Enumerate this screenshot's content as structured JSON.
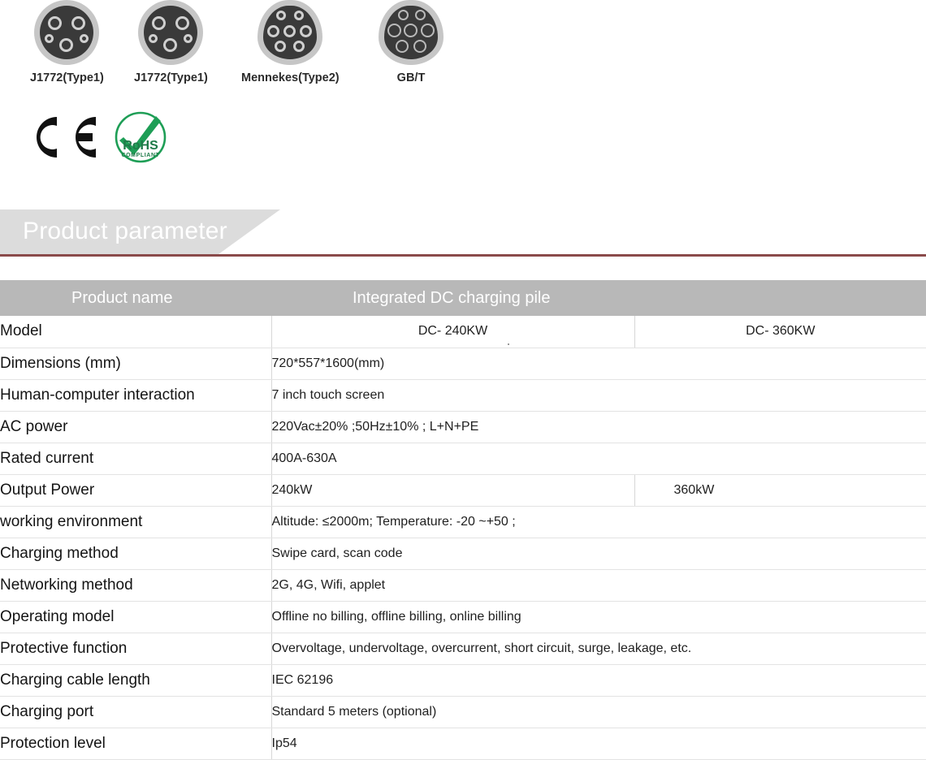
{
  "connectors": [
    {
      "label": "J1772(Type1)",
      "icon": "j1772-type1-connector-icon",
      "shape": "round"
    },
    {
      "label": "J1772(Type1)",
      "icon": "j1772-type1-connector-icon",
      "shape": "round"
    },
    {
      "label": "Mennekes(Type2)",
      "icon": "mennekes-type2-connector-icon",
      "shape": "dshape"
    },
    {
      "label": "GB/T",
      "icon": "gbt-connector-icon",
      "shape": "dshape"
    }
  ],
  "certifications": [
    {
      "name": "ce-mark-icon",
      "label": "CE"
    },
    {
      "name": "rohs-compliant-icon",
      "label": "RoHS",
      "sublabel": "COMPLIANT"
    }
  ],
  "section": {
    "title": "Product parameter",
    "rule_color": "#8a4a4a",
    "banner_color": "#dcdcdc"
  },
  "table": {
    "header": {
      "name_label": "Product name",
      "value_label": "Integrated DC charging pile",
      "background": "#b8b8b8"
    },
    "rows": [
      {
        "label": "Model",
        "value_a": "DC-  240KW",
        "value_b": "DC-  360KW",
        "split": true,
        "centered": true
      },
      {
        "label": "Dimensions (mm)",
        "value_a": "720*557*1600(mm)",
        "split": false,
        "centered": false
      },
      {
        "label": "Human-computer interaction",
        "value_a": "7 inch touch screen",
        "split": false,
        "centered": false
      },
      {
        "label": "AC power",
        "value_a": "220Vac±20% ;50Hz±10% ; L+N+PE",
        "split": false,
        "centered": false
      },
      {
        "label": "Rated current",
        "value_a": "400A-630A",
        "split": false,
        "centered": false
      },
      {
        "label": "Output Power",
        "value_a": "240kW",
        "value_b": "360kW",
        "split": true,
        "centered": false
      },
      {
        "label": "working environment",
        "value_a": "Altitude: ≤2000m; Temperature: -20  ~+50  ;",
        "split": false,
        "centered": false
      },
      {
        "label": "Charging method",
        "value_a": "Swipe card, scan code",
        "split": false,
        "centered": false
      },
      {
        "label": "Networking method",
        "value_a": "2G, 4G, Wifi, applet",
        "split": false,
        "centered": false
      },
      {
        "label": "Operating model",
        "value_a": "Offline no billing, offline billing, online billing",
        "split": false,
        "centered": false
      },
      {
        "label": "Protective function",
        "value_a": "Overvoltage, undervoltage, overcurrent, short circuit, surge, leakage, etc.",
        "split": false,
        "centered": false
      },
      {
        "label": "Charging cable length",
        "value_a": "IEC   62196",
        "split": false,
        "centered": false
      },
      {
        "label": "Charging port",
        "value_a": "Standard 5 meters (optional)",
        "split": false,
        "centered": false
      },
      {
        "label": "Protection level",
        "value_a": "Ip54",
        "split": false,
        "centered": false
      }
    ]
  }
}
